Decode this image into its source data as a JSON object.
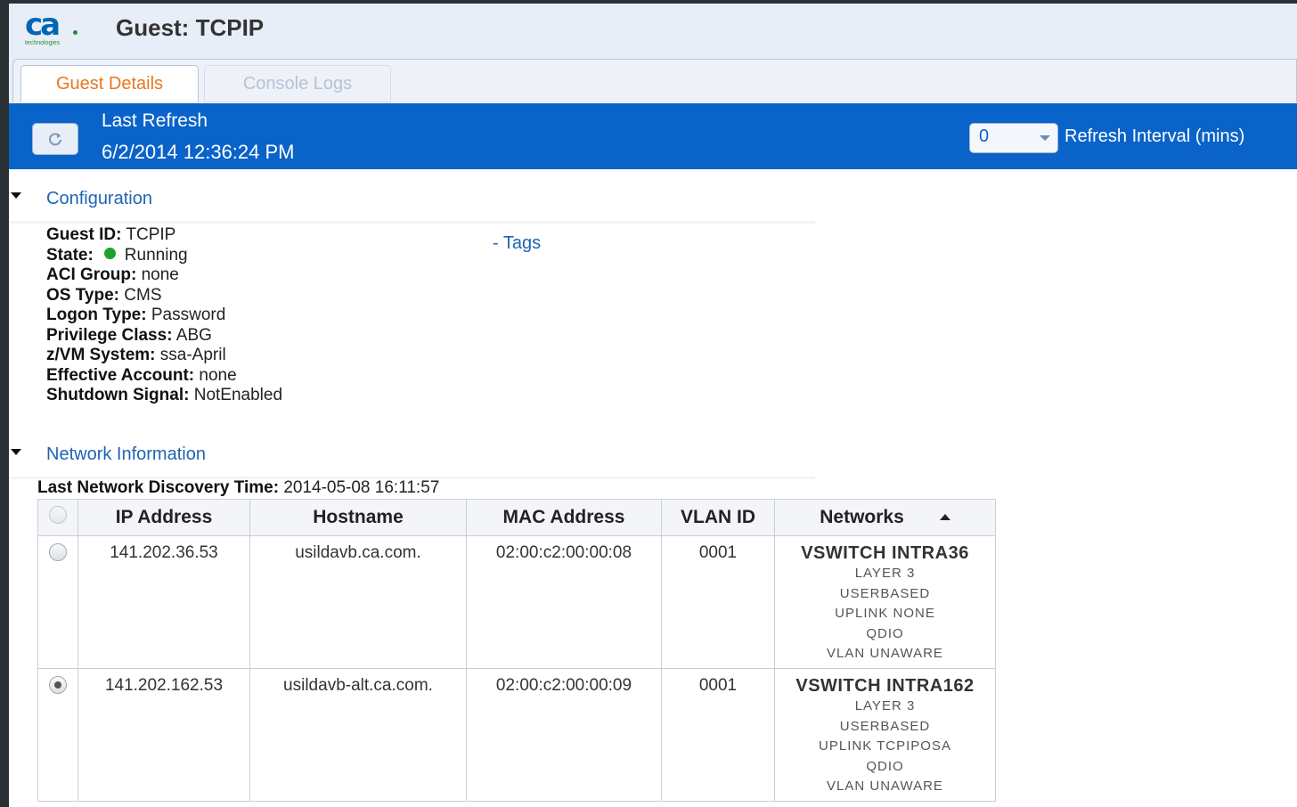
{
  "header": {
    "logo_text": "ca",
    "logo_sub": "technologies",
    "title": "Guest: TCPIP"
  },
  "tabs": [
    {
      "label": "Guest Details",
      "active": true
    },
    {
      "label": "Console Logs",
      "active": false
    }
  ],
  "refresh": {
    "label": "Last Refresh",
    "time": "6/2/2014 12:36:24 PM",
    "interval_value": "0",
    "interval_label": "Refresh Interval (mins)"
  },
  "configuration": {
    "title": "Configuration",
    "tags_link": "- Tags",
    "fields": [
      {
        "key": "Guest ID:",
        "value": "TCPIP"
      },
      {
        "key": "State:",
        "value": "Running",
        "status_color": "#1ea12b"
      },
      {
        "key": "ACI Group:",
        "value": "none"
      },
      {
        "key": "OS Type:",
        "value": "CMS"
      },
      {
        "key": "Logon Type:",
        "value": "Password"
      },
      {
        "key": "Privilege Class:",
        "value": "ABG"
      },
      {
        "key": "z/VM System:",
        "value": "ssa-April"
      },
      {
        "key": "Effective Account:",
        "value": "none"
      },
      {
        "key": "Shutdown Signal:",
        "value": "NotEnabled"
      }
    ]
  },
  "network": {
    "title": "Network Information",
    "discovery_label": "Last Network Discovery Time:",
    "discovery_value": "2014-05-08 16:11:57",
    "columns": [
      "IP Address",
      "Hostname",
      "MAC Address",
      "VLAN ID",
      "Networks"
    ],
    "rows": [
      {
        "selected": false,
        "ip": "141.202.36.53",
        "hostname": "usildavb.ca.com.",
        "mac": "02:00:c2:00:00:08",
        "vlan": "0001",
        "network_name": "VSWITCH INTRA36",
        "network_details": [
          "LAYER 3",
          "USERBASED",
          "UPLINK NONE",
          "QDIO",
          "VLAN UNAWARE"
        ]
      },
      {
        "selected": true,
        "ip": "141.202.162.53",
        "hostname": "usildavb-alt.ca.com.",
        "mac": "02:00:c2:00:00:09",
        "vlan": "0001",
        "network_name": "VSWITCH INTRA162",
        "network_details": [
          "LAYER 3",
          "USERBASED",
          "UPLINK TCPIPOSA",
          "QDIO",
          "VLAN UNAWARE"
        ]
      }
    ]
  },
  "colors": {
    "accent_blue": "#0a63c9",
    "active_tab": "#e87722",
    "link": "#1d64b5",
    "running": "#1ea12b"
  }
}
